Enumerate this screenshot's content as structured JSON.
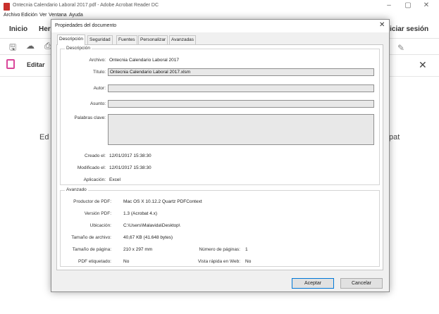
{
  "app": {
    "title": "Ontecnia Calendario Laboral 2017.pdf - Adobe Acrobat Reader DC",
    "window_buttons": [
      "–",
      "▢",
      "✕"
    ],
    "menu": [
      "Archivo",
      "Edición",
      "Ver",
      "Ventana",
      "Ayuda"
    ],
    "tabs": {
      "home": "Inicio",
      "tools_partial": "Her"
    },
    "sign_in_partial": "niciar sesión",
    "edit_panel_label": "Editar",
    "bg_left_fragment": "Ed",
    "bg_right_fragment": "pat",
    "close_glyph": "✕"
  },
  "dialog": {
    "title": "Propiedades del documento",
    "close_glyph": "✕",
    "tabs": [
      "Descripción",
      "Seguridad",
      "Fuentes",
      "Personalizar",
      "Avanzadas"
    ],
    "active_tab": "Descripción",
    "description": {
      "group_title": "Descripción",
      "file_label": "Archivo:",
      "file_value": "Ontecnia Calendario Laboral 2017",
      "title_label": "Título:",
      "title_value": "Ontecnia Calendario Laboral 2017.xlsm",
      "author_label": "Autor:",
      "author_value": "",
      "subject_label": "Asunto:",
      "subject_value": "",
      "keywords_label": "Palabras clave:",
      "keywords_value": "",
      "created_label": "Creado el:",
      "created_value": "12/01/2017 15:38:30",
      "modified_label": "Modificado el:",
      "modified_value": "12/01/2017 15:38:30",
      "application_label": "Aplicación:",
      "application_value": "Excel"
    },
    "advanced": {
      "group_title": "Avanzado",
      "producer_label": "Productor de PDF:",
      "producer_value": "Mac OS X 10.12.2 Quartz PDFContext",
      "version_label": "Versión PDF:",
      "version_value": "1.3 (Acrobat 4.x)",
      "location_label": "Ubicación:",
      "location_value": "C:\\Users\\Malavida\\Desktop\\",
      "filesize_label": "Tamaño de archivo:",
      "filesize_value": "40,67 KB (41.648 bytes)",
      "pagesize_label": "Tamaño de página:",
      "pagesize_value": "210 x 297 mm",
      "pagecount_label": "Número de páginas:",
      "pagecount_value": "1",
      "tagged_label": "PDF etiquetado:",
      "tagged_value": "No",
      "fastweb_label": "Vista rápida en Web:",
      "fastweb_value": "No"
    },
    "buttons": {
      "ok": "Aceptar",
      "cancel": "Cancelar"
    }
  }
}
